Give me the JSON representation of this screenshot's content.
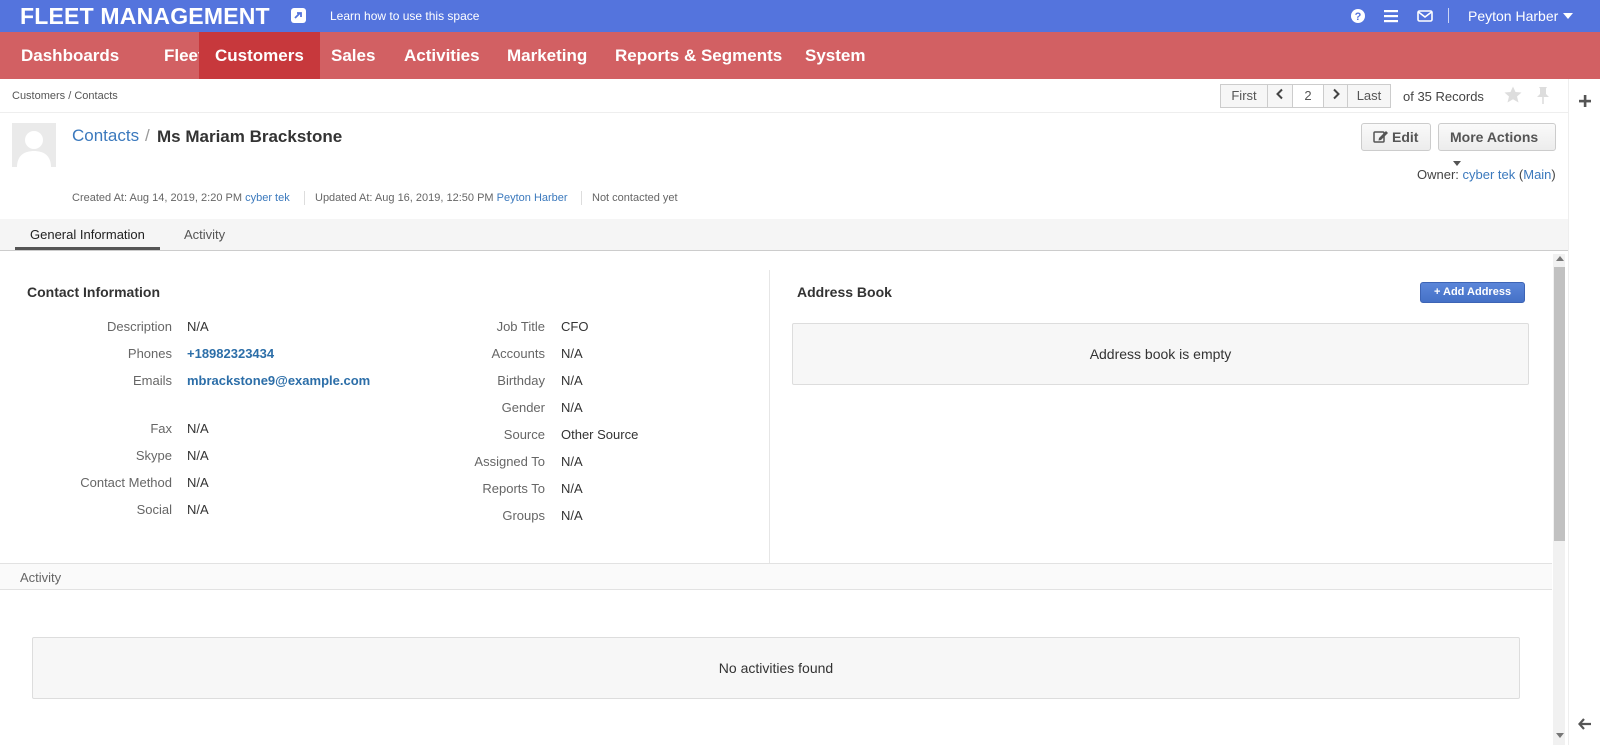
{
  "topbar": {
    "app_title": "FLEET MANAGEMENT",
    "learn_link": "Learn how to use this space",
    "user_name": "Peyton Harber",
    "icons": [
      "external-link-icon",
      "help-icon",
      "menu-icon",
      "mail-icon"
    ]
  },
  "nav": {
    "items": [
      "Dashboards",
      "Fleet",
      "Customers",
      "Sales",
      "Activities",
      "Marketing",
      "Reports & Segments",
      "System"
    ],
    "active": "Customers"
  },
  "breadcrumb": "Customers / Contacts",
  "pager": {
    "first": "First",
    "page": "2",
    "last": "Last",
    "records": "of 35 Records"
  },
  "header": {
    "entity_link": "Contacts",
    "separator": "/",
    "name": "Ms Mariam Brackstone",
    "edit_label": "Edit",
    "more_actions_label": "More Actions",
    "owner_label": "Owner:",
    "owner_name": "cyber tek",
    "owner_bu": "Main",
    "created_label": "Created At: Aug 14, 2019, 2:20 PM",
    "created_by": "cyber tek",
    "updated_label": "Updated At: Aug 16, 2019, 12:50 PM",
    "updated_by": "Peyton Harber",
    "contact_status": "Not contacted yet"
  },
  "tabs": [
    "General Information",
    "Activity"
  ],
  "contact_info": {
    "title": "Contact Information",
    "left": [
      {
        "label": "Description",
        "value": "N/A"
      },
      {
        "label": "Phones",
        "value": "+18982323434"
      },
      {
        "label": "Emails",
        "value": "mbrackstone9@example.com"
      },
      {
        "label": "Fax",
        "value": "N/A"
      },
      {
        "label": "Skype",
        "value": "N/A"
      },
      {
        "label": "Contact Method",
        "value": "N/A"
      },
      {
        "label": "Social",
        "value": "N/A"
      }
    ],
    "right": [
      {
        "label": "Job Title",
        "value": "CFO"
      },
      {
        "label": "Accounts",
        "value": "N/A"
      },
      {
        "label": "Birthday",
        "value": "N/A"
      },
      {
        "label": "Gender",
        "value": "N/A"
      },
      {
        "label": "Source",
        "value": "Other Source"
      },
      {
        "label": "Assigned To",
        "value": "N/A"
      },
      {
        "label": "Reports To",
        "value": "N/A"
      },
      {
        "label": "Groups",
        "value": "N/A"
      }
    ]
  },
  "address_book": {
    "title": "Address Book",
    "add_label": "+ Add Address",
    "empty_text": "Address book is empty"
  },
  "activity": {
    "title": "Activity",
    "empty_text": "No activities found"
  },
  "colors": {
    "topbar": "#5474dd",
    "nav": "#d26063",
    "nav_active": "#c7383c",
    "link": "#3b79bd"
  }
}
